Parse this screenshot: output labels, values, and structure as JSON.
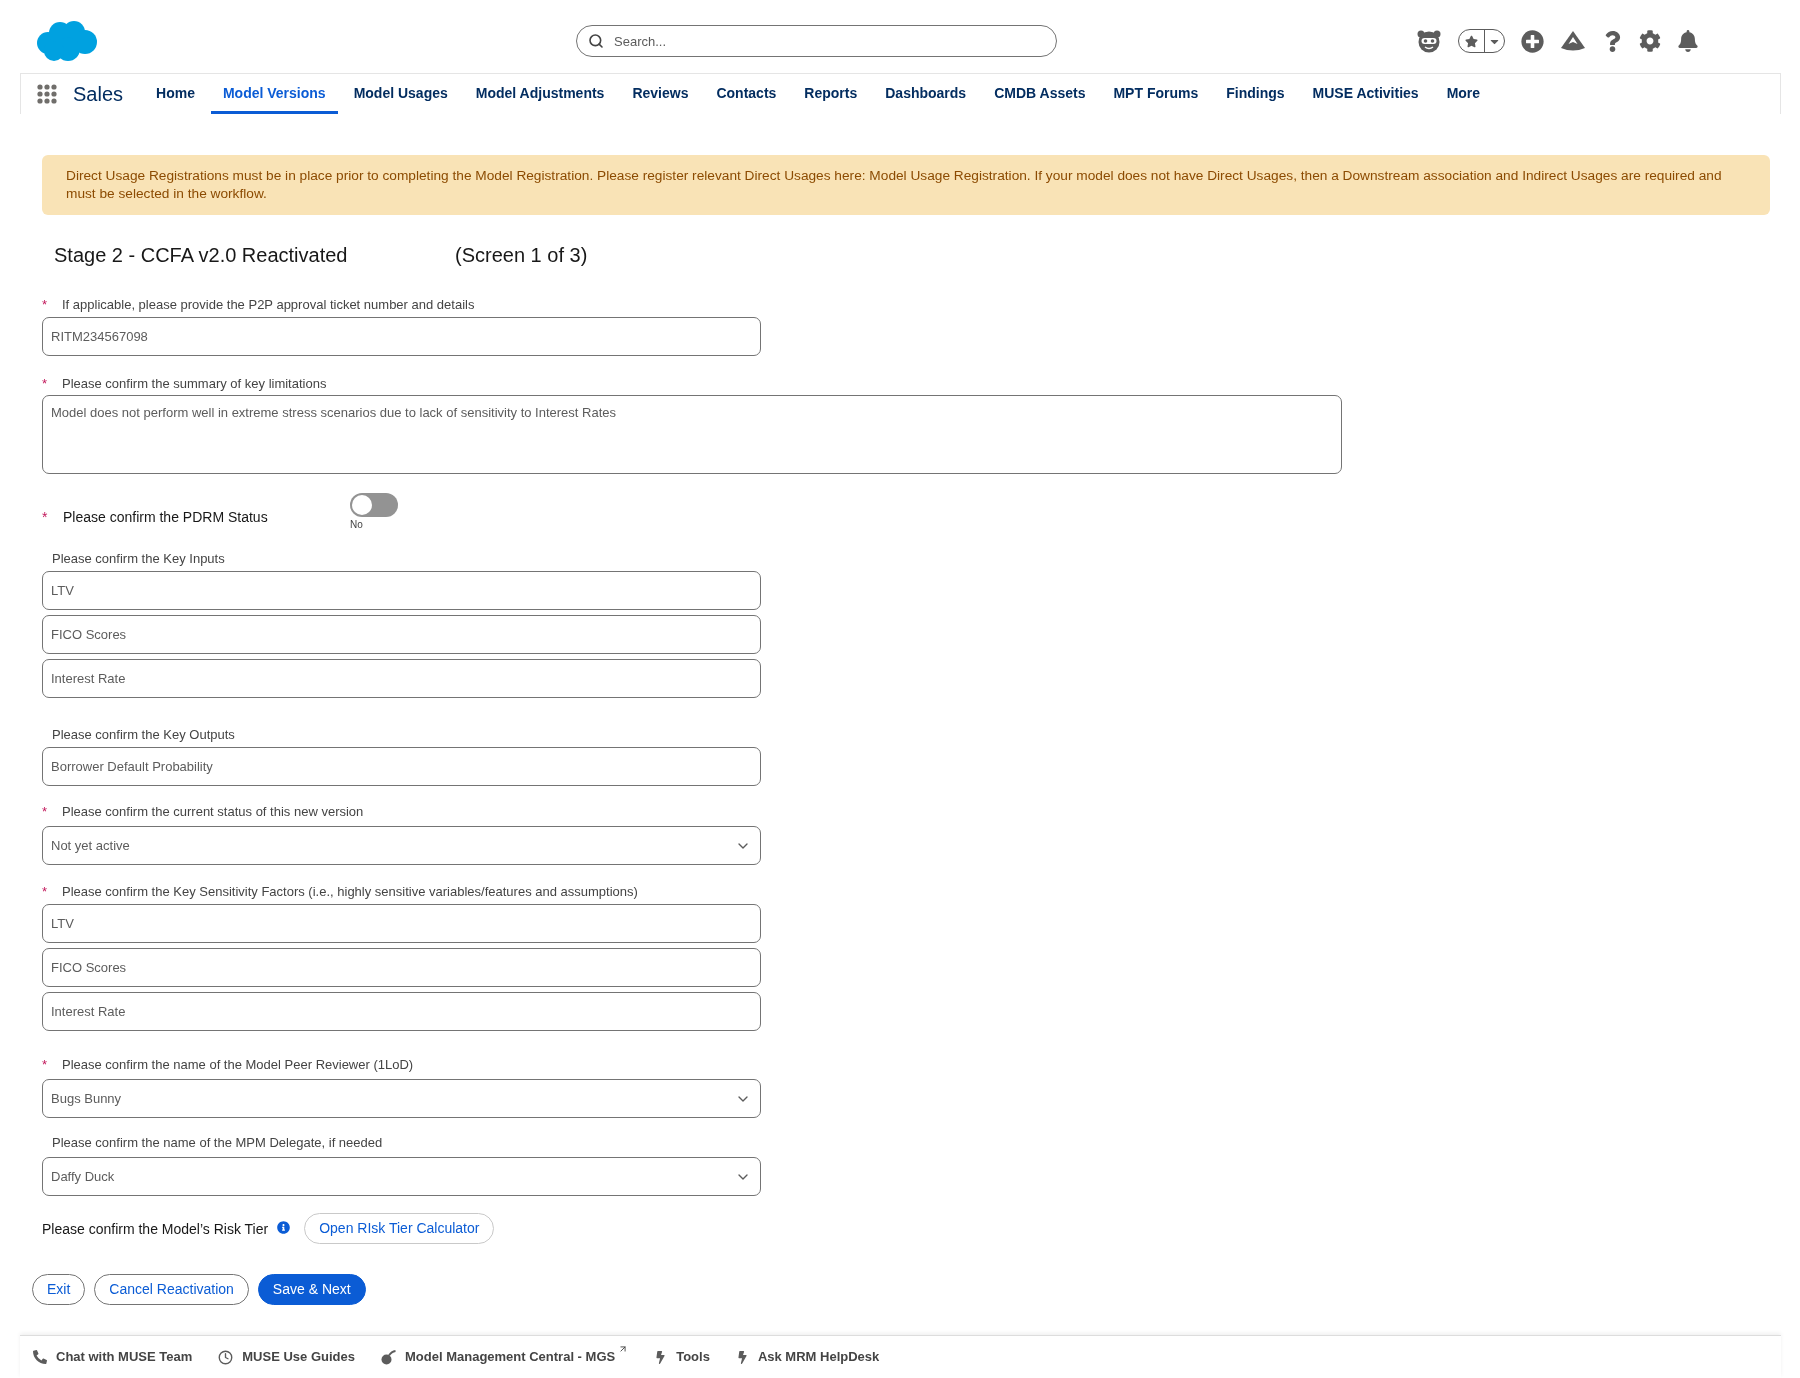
{
  "header": {
    "search": {
      "placeholder": "Search..."
    }
  },
  "app_nav": {
    "app_name": "Sales",
    "tabs": [
      {
        "label": "Home",
        "selected": false
      },
      {
        "label": "Model Versions",
        "selected": true
      },
      {
        "label": "Model Usages",
        "selected": false
      },
      {
        "label": "Model Adjustments",
        "selected": false
      },
      {
        "label": "Reviews",
        "selected": false
      },
      {
        "label": "Contacts",
        "selected": false
      },
      {
        "label": "Reports",
        "selected": false
      },
      {
        "label": "Dashboards",
        "selected": false
      },
      {
        "label": "CMDB Assets",
        "selected": false
      },
      {
        "label": "MPT Forums",
        "selected": false
      },
      {
        "label": "Findings",
        "selected": false
      },
      {
        "label": "MUSE Activities",
        "selected": false
      },
      {
        "label": "More",
        "selected": false
      }
    ]
  },
  "banner": {
    "text": "Direct Usage Registrations must be in place prior to completing the Model Registration. Please register relevant Direct Usages here: Model Usage Registration. If your model does not have Direct Usages, then a Downstream association and Indirect Usages are required and must be selected in the workflow."
  },
  "form": {
    "title": "Stage 2 - CCFA v2.0 Reactivated",
    "screen_indicator": "(Screen 1 of 3)",
    "fields": [
      {
        "kind": "text",
        "required_mark": "*",
        "label": "If applicable, please provide the P2P approval ticket number and details",
        "value": "RITM234567098"
      },
      {
        "kind": "textarea",
        "required_mark": "*",
        "label": "Please confirm the summary of key limitations",
        "value": "Model does not perform well in extreme stress scenarios due to lack of sensitivity to Interest Rates"
      },
      {
        "kind": "toggle",
        "required_mark": "*",
        "label": "Please confirm the PDRM Status",
        "on": false,
        "state_label": "No"
      },
      {
        "kind": "multi_text",
        "label": "Please confirm the Key Inputs",
        "values": [
          "LTV",
          "FICO Scores",
          "Interest Rate"
        ]
      },
      {
        "kind": "multi_text",
        "label": "Please confirm the Key Outputs",
        "values": [
          "Borrower Default Probability"
        ]
      },
      {
        "kind": "select",
        "required_mark": "*",
        "label": "Please confirm the current status of this new version",
        "value": "Not yet active"
      },
      {
        "kind": "multi_text",
        "required_mark": "*",
        "label": "Please confirm the Key Sensitivity Factors (i.e., highly sensitive variables/features and assumptions)",
        "values": [
          "LTV",
          "FICO Scores",
          "Interest Rate"
        ]
      },
      {
        "kind": "select",
        "required_mark": "*",
        "label": "Please confirm the name of the Model Peer Reviewer (1LoD)",
        "value": "Bugs Bunny"
      },
      {
        "kind": "select",
        "label": "Please confirm the name of the MPM Delegate, if needed",
        "value": "Daffy Duck"
      },
      {
        "kind": "calculator",
        "label": "Please confirm the Model’s Risk Tier",
        "button": "Open RIsk Tier Calculator"
      }
    ]
  },
  "actions": [
    {
      "label": "Exit",
      "kind": "neutral"
    },
    {
      "label": "Cancel Reactivation",
      "kind": "neutral"
    },
    {
      "label": "Save & Next",
      "kind": "brand"
    }
  ],
  "utility_bar": [
    {
      "label": "Chat with MUSE Team",
      "external": false
    },
    {
      "label": "MUSE Use Guides",
      "external": false
    },
    {
      "label": "Model Management Central - MGS",
      "external": true
    },
    {
      "label": "Tools",
      "external": false
    },
    {
      "label": "Ask MRM HelpDesk",
      "external": false
    }
  ]
}
